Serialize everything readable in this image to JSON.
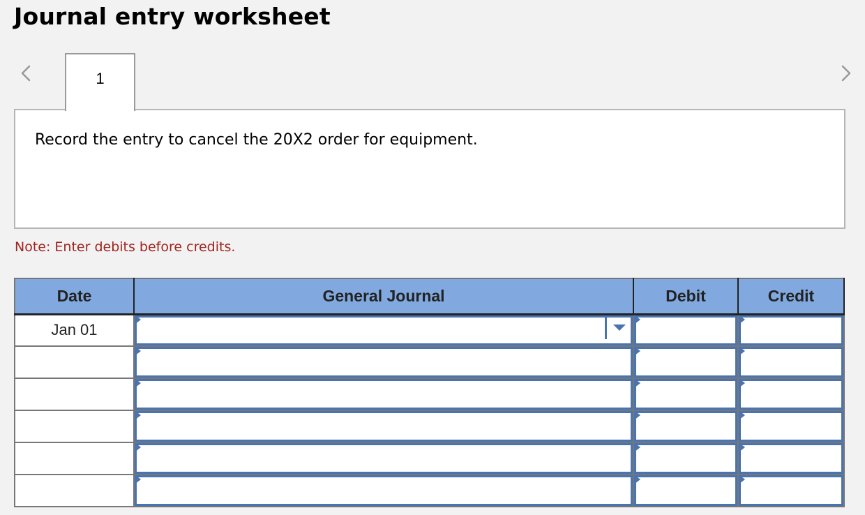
{
  "header": {
    "title": "Journal entry worksheet"
  },
  "navigation": {
    "prev_icon": "chevron-left-icon",
    "next_icon": "chevron-right-icon",
    "tabs": [
      {
        "label": "1",
        "active": true
      }
    ]
  },
  "prompt": {
    "text": "Record the entry to cancel the 20X2 order for equipment."
  },
  "note": {
    "text": "Note: Enter debits before credits.",
    "color": "#a0241e"
  },
  "journal": {
    "columns": [
      "Date",
      "General Journal",
      "Debit",
      "Credit"
    ],
    "header_color": "#81a9df",
    "input_border_color": "#4a74b0",
    "rows": [
      {
        "date": "Jan 01",
        "account": "",
        "debit": "",
        "credit": "",
        "has_dropdown": true
      },
      {
        "date": "",
        "account": "",
        "debit": "",
        "credit": ""
      },
      {
        "date": "",
        "account": "",
        "debit": "",
        "credit": ""
      },
      {
        "date": "",
        "account": "",
        "debit": "",
        "credit": ""
      },
      {
        "date": "",
        "account": "",
        "debit": "",
        "credit": ""
      },
      {
        "date": "",
        "account": "",
        "debit": "",
        "credit": ""
      }
    ]
  }
}
